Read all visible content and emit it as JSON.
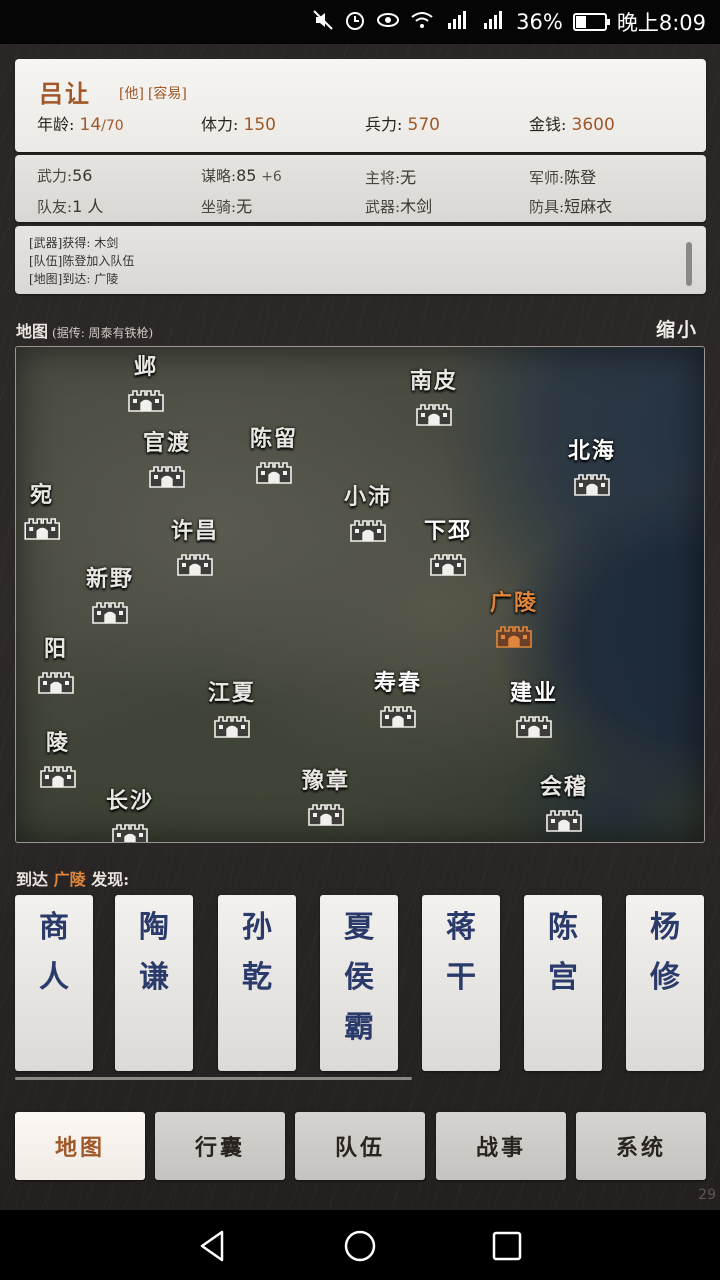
{
  "status_bar": {
    "icons": [
      "mute-icon",
      "alarm-icon",
      "eye-icon",
      "wifi-icon",
      "signal-4g-icon",
      "signal-x-icon"
    ],
    "battery_text": "36%",
    "battery_level": 0.36,
    "time": "晚上8:09"
  },
  "character": {
    "name": "吕让",
    "tags": [
      "[他]",
      "[容易]"
    ],
    "age_label": "年龄:",
    "age_value": "14",
    "age_max": "/70",
    "stamina_label": "体力:",
    "stamina_value": "150",
    "troops_label": "兵力:",
    "troops_value": "570",
    "money_label": "金钱:",
    "money_value": "3600"
  },
  "stats": {
    "row1": [
      {
        "label": "武力:",
        "value": "56",
        "bonus": ""
      },
      {
        "label": "谋略:",
        "value": "85",
        "bonus": "+6"
      },
      {
        "label": "主将:",
        "value": "无",
        "bonus": ""
      },
      {
        "label": "军师:",
        "value": "陈登",
        "bonus": ""
      }
    ],
    "row2": [
      {
        "label": "队友:",
        "value": "1 人",
        "bonus": ""
      },
      {
        "label": "坐骑:",
        "value": "无",
        "bonus": ""
      },
      {
        "label": "武器:",
        "value": "木剑",
        "bonus": ""
      },
      {
        "label": "防具:",
        "value": "短麻衣",
        "bonus": ""
      }
    ]
  },
  "log": {
    "lines": [
      "[武器]获得: 木剑",
      "[队伍]陈登加入队伍",
      "[地图]到达: 广陵"
    ]
  },
  "map": {
    "title": "地图",
    "hint": "(据传: 周泰有铁枪)",
    "shrink_label": "缩小",
    "cities": [
      {
        "name": "邺",
        "style": "normal"
      },
      {
        "name": "南皮",
        "style": "normal"
      },
      {
        "name": "官渡",
        "style": "normal"
      },
      {
        "name": "陈留",
        "style": "normal"
      },
      {
        "name": "北海",
        "style": "strong"
      },
      {
        "name": "小沛",
        "style": "normal"
      },
      {
        "name": "许昌",
        "style": "normal"
      },
      {
        "name": "下邳",
        "style": "strong"
      },
      {
        "name": "新野",
        "style": "normal"
      },
      {
        "name": "广陵",
        "style": "current"
      },
      {
        "name": "阳",
        "style": "normal"
      },
      {
        "name": "江夏",
        "style": "normal"
      },
      {
        "name": "寿春",
        "style": "strong"
      },
      {
        "name": "建业",
        "style": "strong"
      },
      {
        "name": "陵",
        "style": "normal"
      },
      {
        "name": "豫章",
        "style": "normal"
      },
      {
        "name": "会稽",
        "style": "normal"
      },
      {
        "name": "长沙",
        "style": "normal"
      },
      {
        "name": "宛",
        "style": "normal"
      }
    ]
  },
  "arrival": {
    "prefix": "到达",
    "location": "广陵",
    "suffix": "发现:"
  },
  "people": [
    {
      "name": "商人"
    },
    {
      "name": "陶谦"
    },
    {
      "name": "孙乾"
    },
    {
      "name": "夏侯霸"
    },
    {
      "name": "蒋干"
    },
    {
      "name": "陈宫"
    },
    {
      "name": "杨修"
    }
  ],
  "tabs": [
    {
      "label": "地图",
      "active": true
    },
    {
      "label": "行囊",
      "active": false
    },
    {
      "label": "队伍",
      "active": false
    },
    {
      "label": "战事",
      "active": false
    },
    {
      "label": "系统",
      "active": false
    }
  ],
  "page_number": "29",
  "colors": {
    "accent": "#a0582a",
    "current_city": "#e0863c",
    "card_text": "#2a3a6a"
  }
}
